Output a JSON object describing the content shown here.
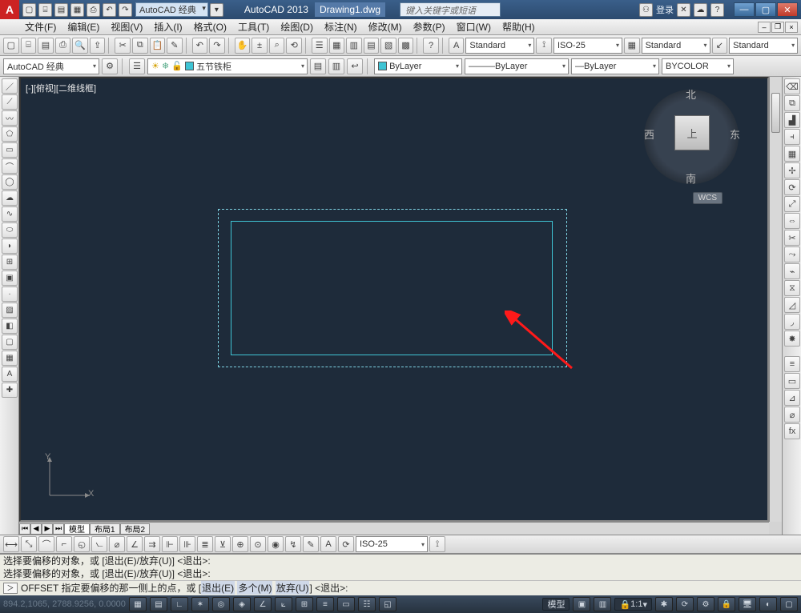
{
  "title": {
    "app": "AutoCAD 2013",
    "file": "Drawing1.dwg",
    "search_ph": "键入关键字或短语",
    "login": "登录",
    "workspace": "AutoCAD 经典"
  },
  "menubar": [
    "文件(F)",
    "编辑(E)",
    "视图(V)",
    "插入(I)",
    "格式(O)",
    "工具(T)",
    "绘图(D)",
    "标注(N)",
    "修改(M)",
    "参数(P)",
    "窗口(W)",
    "帮助(H)"
  ],
  "std": {
    "txt": "Standard",
    "dim": "ISO-25",
    "tbl": "Standard",
    "ml": "Standard"
  },
  "layer": {
    "ws": "AutoCAD 经典",
    "current": "五节铁柜",
    "bylayer": "ByLayer",
    "bycolor": "BYCOLOR"
  },
  "viewport": "[-][俯视][二维线框]",
  "viewcube": {
    "n": "北",
    "s": "南",
    "e": "东",
    "w": "西",
    "top": "上",
    "wcs": "WCS"
  },
  "tabs": {
    "model": "模型",
    "l1": "布局1",
    "l2": "布局2"
  },
  "dim_iso": "ISO-25",
  "cmd": {
    "h1": "选择要偏移的对象，或 [退出(E)/放弃(U)] <退出>:",
    "h2": "选择要偏移的对象，或 [退出(E)/放弃(U)] <退出>:",
    "prompt_pre": "OFFSET 指定要偏移的那一侧上的点，或 [",
    "k1": "退出(E)",
    "k2": "多个(M)",
    "k3": "放弃(U)",
    "prompt_post": "] <退出>:"
  },
  "status": {
    "coords": "894.2,1065, 2788.9256, 0.0000",
    "model": "模型",
    "anno": "1:1"
  },
  "ucs": {
    "x": "X",
    "y": "Y"
  }
}
